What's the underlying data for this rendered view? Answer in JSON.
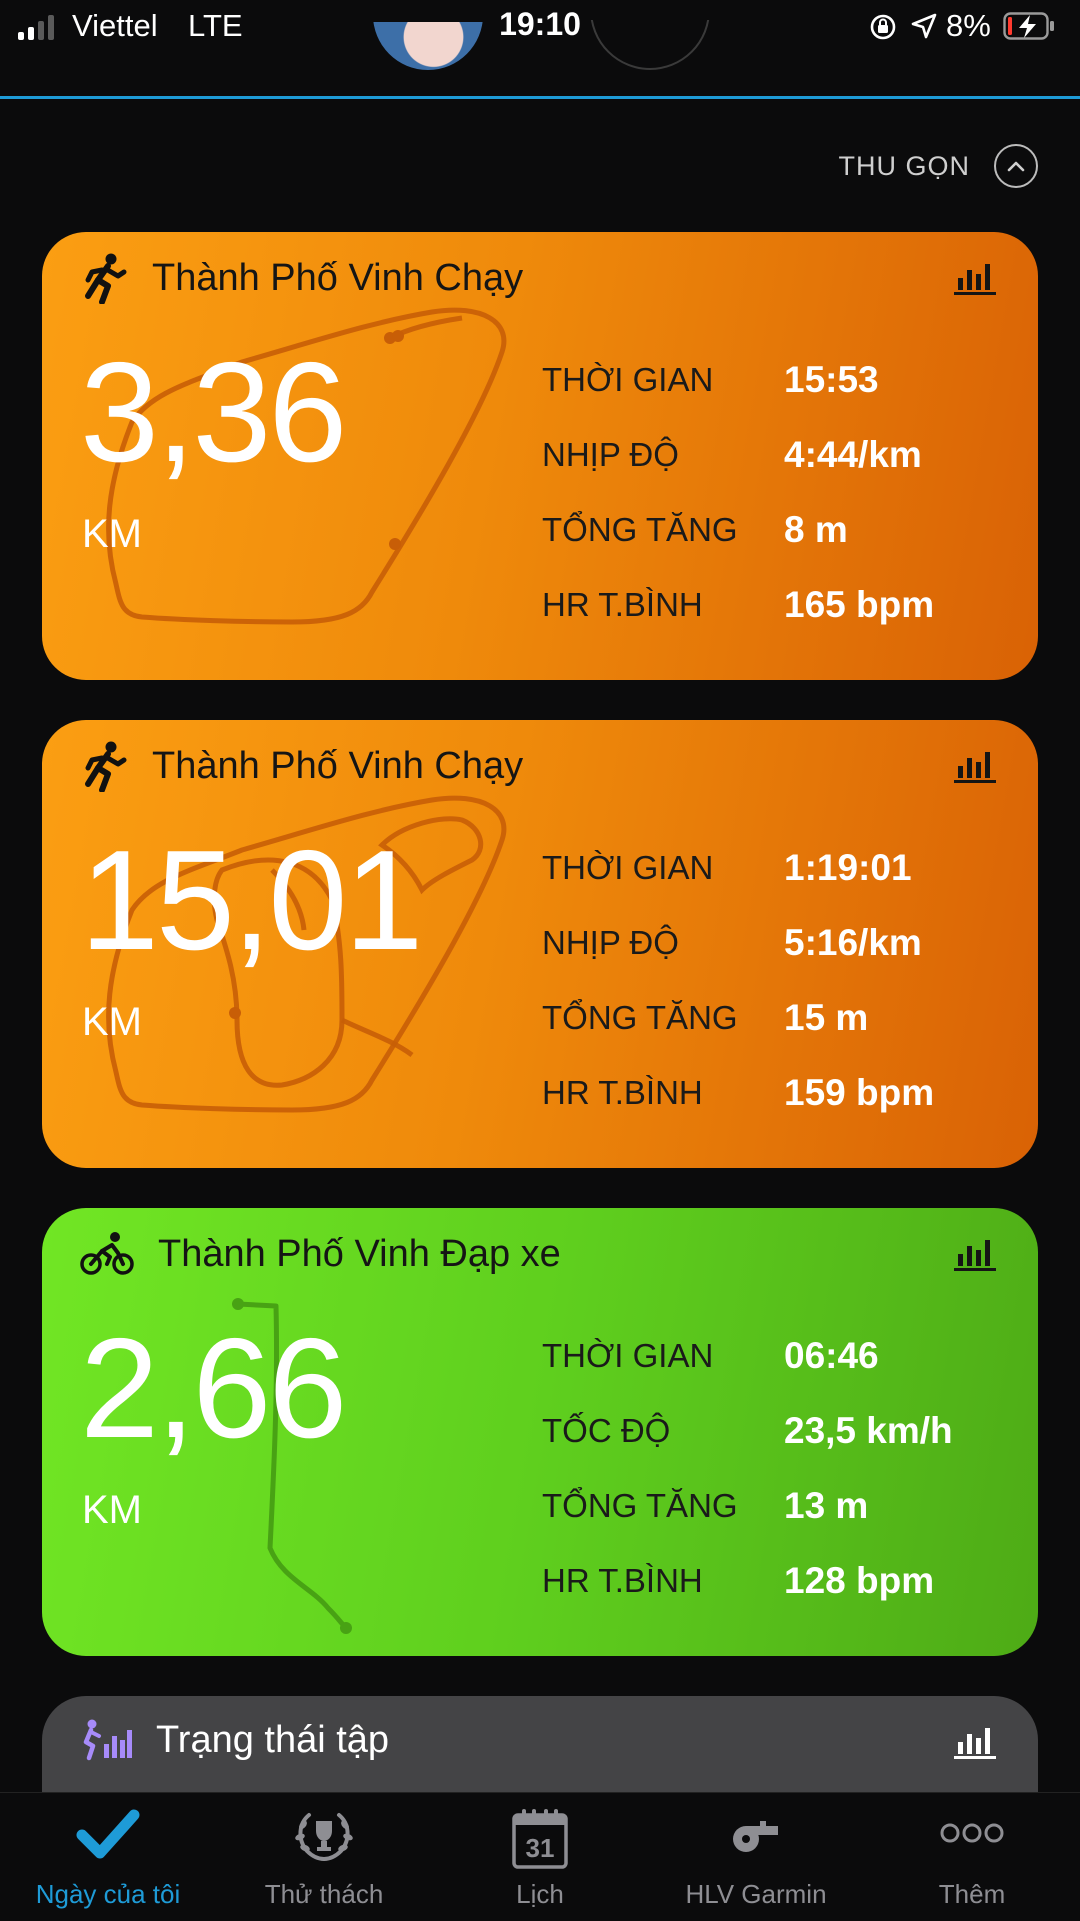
{
  "status_bar": {
    "carrier": "Viettel",
    "network": "LTE",
    "time": "19:10",
    "battery": "8%"
  },
  "collapse": {
    "label": "THU GỌN"
  },
  "activities": [
    {
      "icon": "running-icon",
      "title": "Thành Phố Vinh Chạy",
      "distance": "3,36",
      "unit": "KM",
      "metrics": [
        {
          "label": "THỜI GIAN",
          "value": "15:53"
        },
        {
          "label": "NHỊP ĐỘ",
          "value": "4:44/km"
        },
        {
          "label": "TỔNG TĂNG",
          "value": "8 m"
        },
        {
          "label": "HR T.BÌNH",
          "value": "165 bpm"
        }
      ]
    },
    {
      "icon": "running-icon",
      "title": "Thành Phố Vinh Chạy",
      "distance": "15,01",
      "unit": "KM",
      "metrics": [
        {
          "label": "THỜI GIAN",
          "value": "1:19:01"
        },
        {
          "label": "NHỊP ĐỘ",
          "value": "5:16/km"
        },
        {
          "label": "TỔNG TĂNG",
          "value": "15 m"
        },
        {
          "label": "HR T.BÌNH",
          "value": "159 bpm"
        }
      ]
    },
    {
      "icon": "cycling-icon",
      "title": "Thành Phố Vinh Đạp xe",
      "distance": "2,66",
      "unit": "KM",
      "metrics": [
        {
          "label": "THỜI GIAN",
          "value": "06:46"
        },
        {
          "label": "TỐC ĐỘ",
          "value": "23,5 km/h"
        },
        {
          "label": "TỔNG TĂNG",
          "value": "13 m"
        },
        {
          "label": "HR T.BÌNH",
          "value": "128 bpm"
        }
      ]
    }
  ],
  "training_status": {
    "title": "Trạng thái tập"
  },
  "colors": {
    "run_card_start": "#fb9e12",
    "run_card_end": "#d96205",
    "ride_card_start": "#71e624",
    "ride_card_end": "#4eab16",
    "accent": "#1e9bd7",
    "status_card": "#444446"
  },
  "tabs": [
    {
      "label": "Ngày của tôi",
      "icon": "checkmark-icon",
      "active": true
    },
    {
      "label": "Thử thách",
      "icon": "laurel-trophy-icon",
      "active": false
    },
    {
      "label": "Lịch",
      "icon": "calendar-icon",
      "calendar_day": "31",
      "active": false
    },
    {
      "label": "HLV Garmin",
      "icon": "whistle-icon",
      "active": false
    },
    {
      "label": "Thêm",
      "icon": "more-icon",
      "active": false
    }
  ]
}
